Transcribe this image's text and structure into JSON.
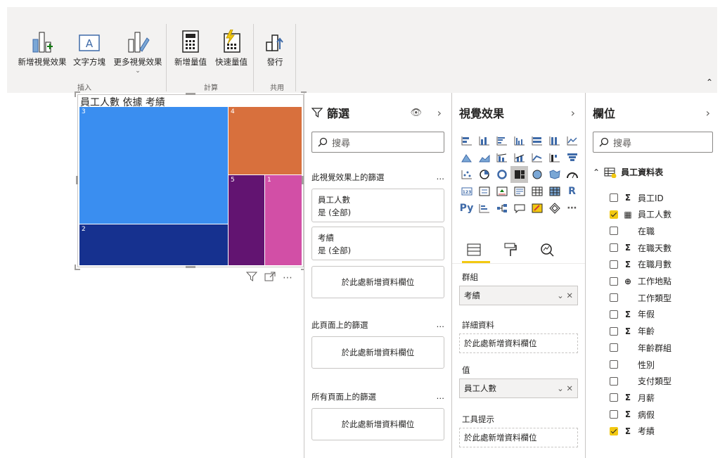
{
  "ribbon": {
    "buttons": [
      {
        "id": "new-visual",
        "label": "新增視覺效果",
        "icon": "new-visual-icon"
      },
      {
        "id": "text-box",
        "label": "文字方塊",
        "icon": "text-box-icon"
      },
      {
        "id": "more-visuals",
        "label": "更多視覺效果",
        "icon": "more-visuals-icon"
      },
      {
        "id": "new-measure",
        "label": "新增量值",
        "icon": "calculator-icon"
      },
      {
        "id": "quick-measure",
        "label": "快速量值",
        "icon": "quick-measure-icon"
      },
      {
        "id": "publish",
        "label": "發行",
        "icon": "publish-icon"
      }
    ],
    "groups": {
      "insert": "插入",
      "calc": "計算",
      "share": "共用"
    }
  },
  "visual": {
    "title": "員工人數 依據 考績",
    "chart_data": {
      "type": "treemap",
      "title": "員工人數 依據 考績",
      "tiles": [
        {
          "label": "3",
          "color": "#3a8ef0"
        },
        {
          "label": "2",
          "color": "#16318f"
        },
        {
          "label": "4",
          "color": "#d8703d"
        },
        {
          "label": "5",
          "color": "#621471"
        },
        {
          "label": "1",
          "color": "#d24fa6"
        }
      ]
    }
  },
  "filters": {
    "title": "篩選",
    "search_placeholder": "搜尋",
    "visual_section": "此視覺效果上的篩選",
    "cards": [
      {
        "field": "員工人數",
        "value": "是 (全部)"
      },
      {
        "field": "考績",
        "value": "是 (全部)"
      }
    ],
    "add_field": "於此處新增資料欄位",
    "page_section": "此頁面上的篩選",
    "all_pages_section": "所有頁面上的篩選",
    "more": "…"
  },
  "viz": {
    "title": "視覺效果",
    "wells": {
      "group_title": "群組",
      "group_value": "考績",
      "details_title": "詳細資料",
      "details_placeholder": "於此處新增資料欄位",
      "values_title": "值",
      "values_value": "員工人數",
      "tooltips_title": "工具提示",
      "tooltips_placeholder": "於此處新增資料欄位"
    }
  },
  "fields": {
    "title": "欄位",
    "search_placeholder": "搜尋",
    "table_name": "員工資料表",
    "items": [
      {
        "name": "員工ID",
        "type": "Σ",
        "checked": false
      },
      {
        "name": "員工人數",
        "type": "▦",
        "checked": true
      },
      {
        "name": "在職",
        "type": "",
        "checked": false
      },
      {
        "name": "在職天數",
        "type": "Σ",
        "checked": false
      },
      {
        "name": "在職月數",
        "type": "Σ",
        "checked": false
      },
      {
        "name": "工作地點",
        "type": "⊕",
        "checked": false
      },
      {
        "name": "工作類型",
        "type": "",
        "checked": false
      },
      {
        "name": "年假",
        "type": "Σ",
        "checked": false
      },
      {
        "name": "年齡",
        "type": "Σ",
        "checked": false
      },
      {
        "name": "年齡群組",
        "type": "",
        "checked": false
      },
      {
        "name": "性別",
        "type": "",
        "checked": false
      },
      {
        "name": "支付類型",
        "type": "",
        "checked": false
      },
      {
        "name": "月薪",
        "type": "Σ",
        "checked": false
      },
      {
        "name": "病假",
        "type": "Σ",
        "checked": false
      },
      {
        "name": "考績",
        "type": "Σ",
        "checked": true
      }
    ]
  }
}
